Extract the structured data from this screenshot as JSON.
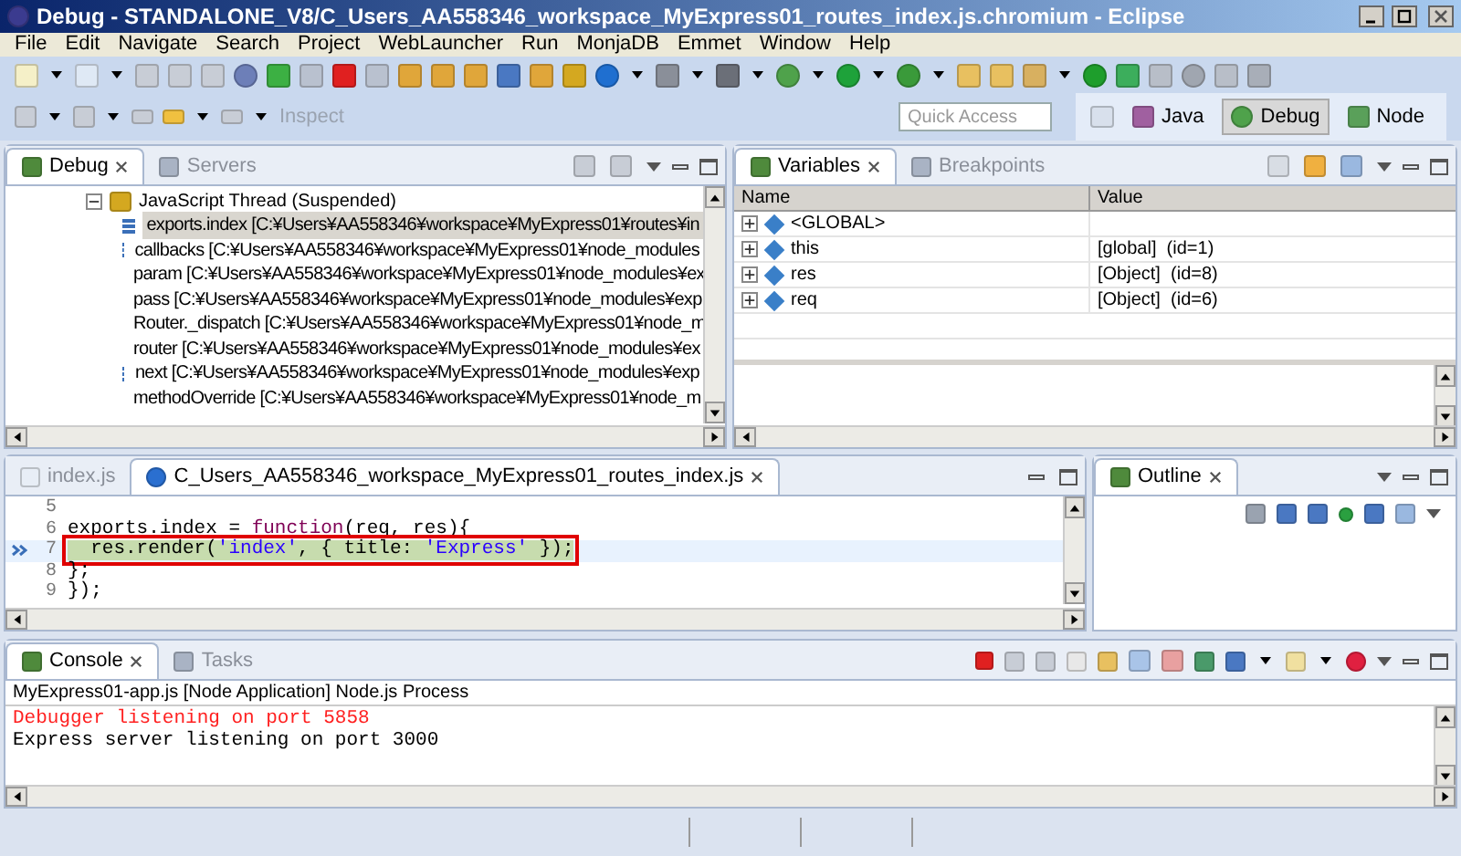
{
  "window": {
    "title": "Debug - STANDALONE_V8/C_Users_AA558346_workspace_MyExpress01_routes_index.js.chromium - Eclipse"
  },
  "menu": [
    "File",
    "Edit",
    "Navigate",
    "Search",
    "Project",
    "WebLauncher",
    "Run",
    "MonjaDB",
    "Emmet",
    "Window",
    "Help"
  ],
  "toolbar": {
    "inspect_label": "Inspect",
    "quick_access": {
      "placeholder": "Quick Access"
    },
    "perspectives": [
      {
        "label": "Java",
        "selected": false
      },
      {
        "label": "Debug",
        "selected": true
      },
      {
        "label": "Node",
        "selected": false
      }
    ]
  },
  "debug_view": {
    "tabs": [
      {
        "label": "Debug",
        "selected": true
      },
      {
        "label": "Servers",
        "selected": false
      }
    ],
    "tree": [
      {
        "label": "JavaScript Thread (Suspended)",
        "expanded": true,
        "children": [
          {
            "label": "exports.index [C:¥Users¥AA558346¥workspace¥MyExpress01¥routes¥in",
            "selected": true
          },
          {
            "label": "callbacks [C:¥Users¥AA558346¥workspace¥MyExpress01¥node_modules",
            "selected": false
          },
          {
            "label": "param [C:¥Users¥AA558346¥workspace¥MyExpress01¥node_modules¥ex",
            "selected": false
          },
          {
            "label": "pass [C:¥Users¥AA558346¥workspace¥MyExpress01¥node_modules¥exp",
            "selected": false
          },
          {
            "label": "Router._dispatch [C:¥Users¥AA558346¥workspace¥MyExpress01¥node_m",
            "selected": false
          },
          {
            "label": "router [C:¥Users¥AA558346¥workspace¥MyExpress01¥node_modules¥ex",
            "selected": false
          },
          {
            "label": "next [C:¥Users¥AA558346¥workspace¥MyExpress01¥node_modules¥exp",
            "selected": false
          },
          {
            "label": "methodOverride [C:¥Users¥AA558346¥workspace¥MyExpress01¥node_m",
            "selected": false
          }
        ]
      }
    ]
  },
  "variables_view": {
    "tabs": [
      {
        "label": "Variables",
        "selected": true
      },
      {
        "label": "Breakpoints",
        "selected": false
      }
    ],
    "columns": [
      "Name",
      "Value"
    ],
    "rows": [
      {
        "name": "<GLOBAL>",
        "value": "",
        "expanded": false
      },
      {
        "name": "this",
        "value": "[global]  (id=1)",
        "expanded": false
      },
      {
        "name": "res",
        "value": "[Object]  (id=8)",
        "expanded": false
      },
      {
        "name": "req",
        "value": "[Object]  (id=6)",
        "expanded": false
      }
    ]
  },
  "editor": {
    "tabs": [
      {
        "label": "index.js",
        "selected": false
      },
      {
        "label": "C_Users_AA558346_workspace_MyExpress01_routes_index.js",
        "selected": true
      }
    ],
    "lines": [
      {
        "number": "5",
        "current": false
      },
      {
        "number": "6",
        "current": false,
        "tokens": [
          {
            "kind": "plain",
            "text": "exports.index = "
          },
          {
            "kind": "keyword",
            "text": "function"
          },
          {
            "kind": "plain",
            "text": "(req, res){"
          }
        ]
      },
      {
        "number": "7",
        "current": true,
        "tokens": [
          {
            "kind": "plain",
            "text": "  res.render("
          },
          {
            "kind": "string",
            "text": "'index'"
          },
          {
            "kind": "plain",
            "text": ", { title: "
          },
          {
            "kind": "string",
            "text": "'Express'"
          },
          {
            "kind": "plain",
            "text": " });"
          }
        ]
      },
      {
        "number": "8",
        "current": false,
        "tokens": [
          {
            "kind": "plain",
            "text": "};"
          }
        ]
      },
      {
        "number": "9",
        "current": false,
        "tokens": [
          {
            "kind": "plain",
            "text": "});"
          }
        ]
      }
    ]
  },
  "outline_view": {
    "tabs": [
      {
        "label": "Outline",
        "selected": true
      }
    ]
  },
  "console_view": {
    "tabs": [
      {
        "label": "Console",
        "selected": true
      },
      {
        "label": "Tasks",
        "selected": false
      }
    ],
    "process": "MyExpress01-app.js [Node Application] Node.js Process",
    "output": [
      {
        "kind": "stderr",
        "text": "Debugger listening on port 5858"
      },
      {
        "kind": "stdout",
        "text": "Express server listening on port 3000"
      }
    ]
  }
}
